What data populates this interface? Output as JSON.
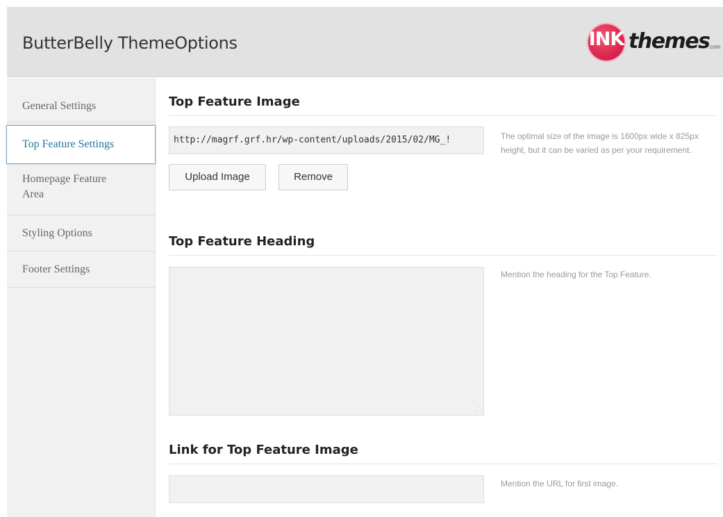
{
  "header": {
    "title": "ButterBelly ThemeOptions",
    "logo": {
      "circle_text": "INK",
      "word_text": "themes",
      "suffix_text": ".com",
      "brand_color": "#d8204a"
    }
  },
  "sidebar": {
    "items": [
      {
        "label": "General Settings",
        "active": false
      },
      {
        "label": "Top Feature Settings",
        "active": true
      },
      {
        "label": "Homepage Feature Area",
        "active": false
      },
      {
        "label": "Styling Options",
        "active": false
      },
      {
        "label": "Footer Settings",
        "active": false
      }
    ],
    "active_color": "#21759b"
  },
  "main": {
    "sections": [
      {
        "title": "Top Feature Image",
        "input_value": "http://magrf.grf.hr/wp-content/uploads/2015/02/MG_!",
        "upload_button_label": "Upload Image",
        "remove_button_label": "Remove",
        "description": "The optimal size of the image is 1600px wide x 825px height, but it can be varied as per your requirement."
      },
      {
        "title": "Top Feature Heading",
        "textarea_value": "",
        "description": "Mention the heading for the Top Feature."
      },
      {
        "title": "Link for Top Feature Image",
        "input_value": "",
        "description": "Mention the URL for first image."
      }
    ]
  }
}
